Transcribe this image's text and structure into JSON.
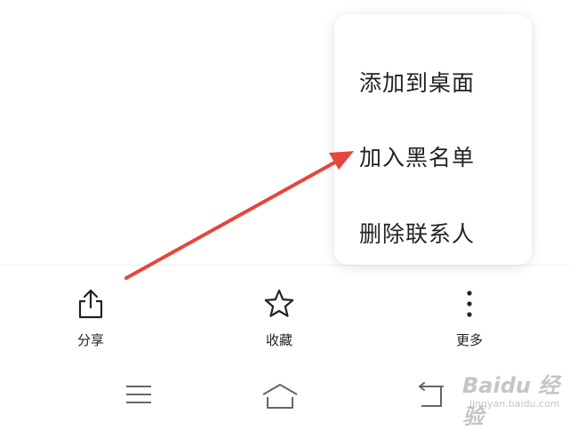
{
  "menu": {
    "items": [
      {
        "label": "添加到桌面"
      },
      {
        "label": "加入黑名单"
      },
      {
        "label": "删除联系人"
      }
    ]
  },
  "actions": {
    "share": {
      "label": "分享",
      "icon": "share-icon"
    },
    "favorite": {
      "label": "收藏",
      "icon": "star-icon"
    },
    "more": {
      "label": "更多",
      "icon": "more-vertical-icon"
    }
  },
  "navbar": {
    "icons": [
      "menu-icon",
      "home-icon",
      "back-icon"
    ]
  },
  "annotation": {
    "color": "#e8453c"
  },
  "watermark": {
    "text": "Baidu 经验",
    "url": "jingyan.baidu.com"
  }
}
